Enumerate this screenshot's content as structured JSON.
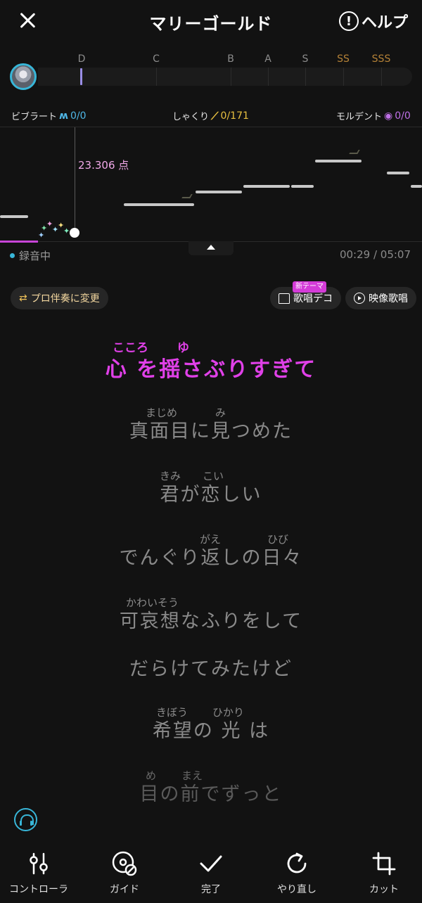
{
  "header": {
    "title": "マリーゴールド",
    "help_label": "ヘルプ"
  },
  "rank": {
    "labels": [
      "D",
      "C",
      "B",
      "A",
      "S",
      "SS",
      "SSS"
    ]
  },
  "techniques": {
    "vibrato": {
      "label": "ビブラート",
      "count": "0/0",
      "color": "#4fb8e8"
    },
    "shakuri": {
      "label": "しゃくり",
      "count": "0/171",
      "color": "#e8c040"
    },
    "mordent": {
      "label": "モルデント",
      "count": "0/0",
      "color": "#c070e8"
    }
  },
  "pitch": {
    "score": "23.306 点"
  },
  "status": {
    "recording": "録音中",
    "time": "00:29 / 05:07"
  },
  "buttons": {
    "pro_label": "プロ伴奏に変更",
    "deco_label": "歌唱デコ",
    "deco_badge": "新テーマ",
    "video_label": "映像歌唱"
  },
  "lyrics": [
    {
      "text": "心 を揺さぶりすぎて",
      "ruby": [
        "こころ",
        "ゆ"
      ],
      "state": "active"
    },
    {
      "text": "真面目に見つめた",
      "ruby": [
        "まじめ",
        "み"
      ],
      "state": "dim"
    },
    {
      "text": "君が恋しい",
      "ruby": [
        "きみ",
        "こい"
      ],
      "state": "dim"
    },
    {
      "text": "でんぐり返しの日々",
      "ruby": [
        "がえ",
        "ひび"
      ],
      "state": "dim"
    },
    {
      "text": "可哀想なふりをして",
      "ruby": [
        "かわいそう"
      ],
      "state": "dim"
    },
    {
      "text": "だらけてみたけど",
      "ruby": [],
      "state": "dim"
    },
    {
      "text": "希望の 光 は",
      "ruby": [
        "きぼう",
        "ひかり"
      ],
      "state": "dim"
    },
    {
      "text": "目の前でずっと",
      "ruby": [
        "め",
        "まえ"
      ],
      "state": "faded"
    }
  ],
  "bottom_bar": {
    "controller": "コントローラ",
    "guide": "ガイド",
    "done": "完了",
    "redo": "やり直し",
    "cut": "カット"
  }
}
